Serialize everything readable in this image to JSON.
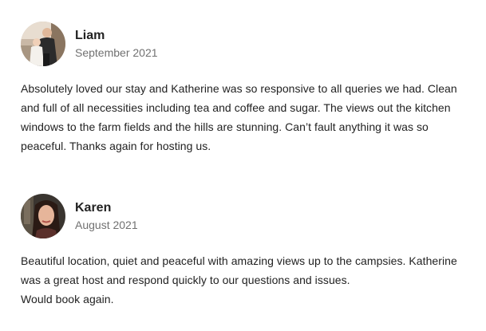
{
  "reviews": [
    {
      "name": "Liam",
      "date": "September 2021",
      "avatar_icon": "user-photo-icon",
      "text_lines": [
        "Absolutely loved our stay and Katherine was so responsive to all queries we had. Clean",
        "and full of all necessities including tea and coffee and sugar. The views out the kitchen",
        "windows to the farm fields and the hills are stunning. Can’t fault anything it was so",
        "peaceful. Thanks again for hosting us."
      ]
    },
    {
      "name": "Karen",
      "date": "August 2021",
      "avatar_icon": "user-photo-icon",
      "text_lines": [
        "Beautiful location, quiet and peaceful with amazing views up to the campsies. Katherine",
        "was a great host and respond quickly to our questions and issues.",
        "Would book again."
      ]
    }
  ],
  "colors": {
    "text": "#222222",
    "muted": "#717171",
    "background": "#ffffff"
  }
}
